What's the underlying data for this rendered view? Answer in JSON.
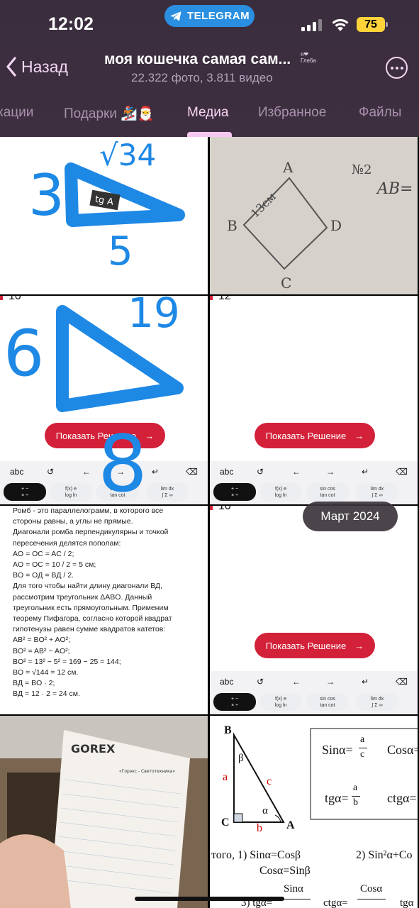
{
  "status_bar": {
    "time": "12:02",
    "pill_label": "TELEGRAM",
    "battery": "75",
    "accent": "#2a8fe0"
  },
  "header": {
    "back_label": "Назад",
    "title": "моя кошечка самая сам...",
    "badge_line1": "я❤",
    "badge_line2": "Глеба",
    "subtitle": "22.322 фото, 3.811 видео"
  },
  "tabs": [
    {
      "label": "кации",
      "active": false
    },
    {
      "label": "Подарки 🏂🎅",
      "active": false
    },
    {
      "label": "Медиа",
      "active": true
    },
    {
      "label": "Избранное",
      "active": false
    },
    {
      "label": "Файлы",
      "active": false
    }
  ],
  "media": {
    "cell1": {
      "num_left": "3",
      "num_top": "√34",
      "num_bottom": "5",
      "tag": "tg A"
    },
    "cell2": {
      "label_a": "A",
      "label_b": "B",
      "label_c": "C",
      "label_d": "D",
      "side": "13см",
      "task": "№2",
      "ab": "AB="
    },
    "cell3": {
      "num_left": "6",
      "num_top": "19",
      "num_bottom": "8"
    },
    "show_solution_label": "Показать Решение",
    "keyboard": {
      "abc": "abc",
      "btn_ops": "+ −\n× ÷",
      "btn_fx": "f(x)  e\nlog  ln",
      "btn_trig": "sin cos\ntan cot",
      "btn_lim": "lim  dx\n∫ Σ ∞"
    },
    "cell3_top": "10",
    "cell4_top": "12",
    "cell6_top": "10",
    "rhombus_lines": [
      "Ромб - это параллелограмм, в которого все",
      "стороны равны, а углы не прямые.",
      "Диагонали ромба перпендикулярны и точкой",
      "пересечения делятся пополам:",
      "AO = OC = AC / 2;",
      "AO = OC = 10 / 2 = 5 см;",
      "BO = OД = BД / 2.",
      "Для того чтобы найти длину диагонали ВД,",
      "рассмотрим треугольник ΔABO. Данный",
      "треугольник есть прямоугольным. Применим",
      "теорему Пифагора, согласно которой квадрат",
      "гипотенузы равен сумме квадратов катетов:",
      "AB² = BO² + AO²;",
      "BO² = AB² − AO²;",
      "BO² = 13² − 5² = 169 − 25 = 144;",
      "BO = √144 = 12 см.",
      "BД = BO · 2;",
      "BД = 12 · 2 = 24 см."
    ],
    "cell7": {
      "logo": "GOREX",
      "org": "«Горэкс - Светотехника»"
    },
    "cell8": {
      "b": "B",
      "a_side": "a",
      "c_side": "c",
      "c_vertex": "C",
      "a_vertex": "A",
      "b_side": "b",
      "beta": "β",
      "alpha": "α",
      "sin": "Sinα=",
      "cos": "Cosα=",
      "tg": "tgα=",
      "ctg": "ctgα=",
      "frac_a": "a",
      "frac_c": "c",
      "frac_b": "b",
      "rule1a": "того,  1)  Sinα=Cosβ",
      "rule1b": "Cosα=Sinβ",
      "rule2": "2) Sin²α+Co",
      "rule3": "3) tgα=",
      "rule3b": "ctgα=",
      "rule3c": "tgα",
      "sina": "Sinα",
      "cosa": "Cosα"
    }
  },
  "date_pill": "Март 2024"
}
